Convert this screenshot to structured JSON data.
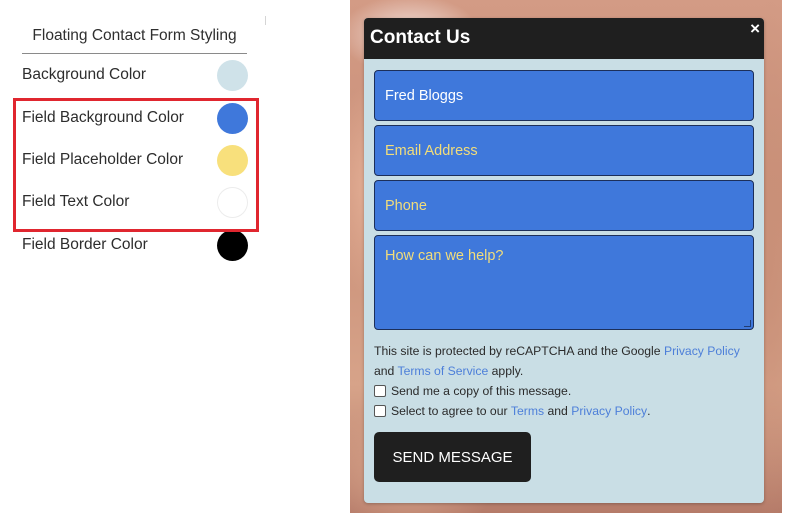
{
  "settings": {
    "title": "Floating Contact Form Styling",
    "rows": [
      {
        "label": "Background Color",
        "color": "#cfe2e9"
      },
      {
        "label": "Field Background Color",
        "color": "#3f78db"
      },
      {
        "label": "Field Placeholder Color",
        "color": "#f8e07c"
      },
      {
        "label": "Field Text Color",
        "color": "#ffffff"
      },
      {
        "label": "Field Border Color",
        "color": "#000000"
      }
    ]
  },
  "form": {
    "title": "Contact Us",
    "close_glyph": "×",
    "fields": {
      "name_value": "Fred Bloggs",
      "email_placeholder": "Email Address",
      "phone_placeholder": "Phone",
      "message_placeholder": "How can we help?"
    },
    "notice": {
      "prefix": "This site is protected by reCAPTCHA and the Google ",
      "privacy_link": "Privacy Policy",
      "middle": " and ",
      "terms_link": "Terms of Service",
      "suffix": " apply."
    },
    "checkboxes": {
      "copy_label": "Send me a copy of this message.",
      "agree_prefix": "Select to agree to our ",
      "agree_terms": "Terms",
      "agree_and": " and ",
      "agree_privacy": "Privacy Policy",
      "agree_end": "."
    },
    "send_label": "SEND MESSAGE"
  },
  "colors": {
    "highlight": "#e0262f",
    "header": "#1f1f1f",
    "field_background": "#3f78db",
    "field_placeholder": "#f2dd7a",
    "link": "#4d7fd9"
  }
}
